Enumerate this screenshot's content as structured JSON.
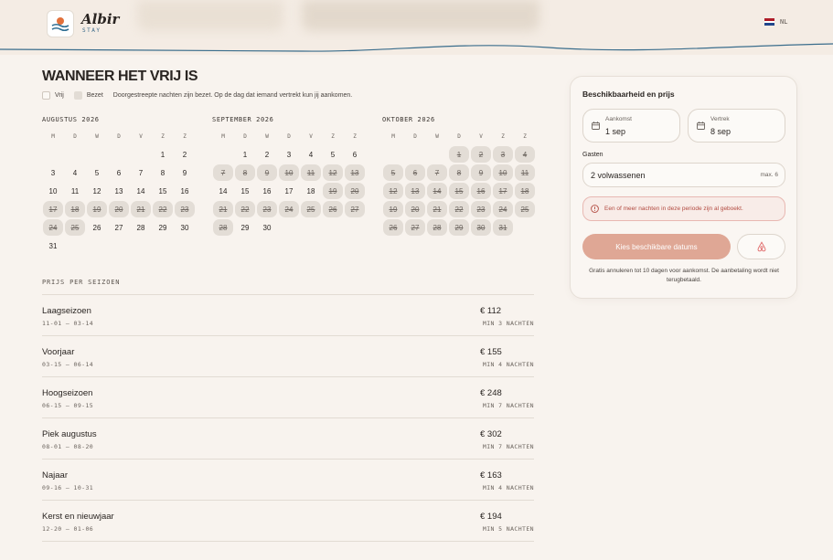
{
  "brand": {
    "name": "Albir",
    "sub": "STAY"
  },
  "language": "NL",
  "availability": {
    "title": "WANNEER HET VRIJ IS",
    "legend": {
      "free": "Vrij",
      "busy": "Bezet",
      "note": "Doorgestreepte nachten zijn bezet. Op de dag dat iemand vertrekt kun jij aankomen."
    },
    "weekdays": [
      "M",
      "D",
      "W",
      "D",
      "V",
      "Z",
      "Z"
    ],
    "months": [
      {
        "name": "AUGUSTUS 2026",
        "offset": 5,
        "days": 31,
        "busy": [
          17,
          18,
          19,
          20,
          21,
          22,
          23,
          24,
          25
        ]
      },
      {
        "name": "SEPTEMBER 2026",
        "offset": 1,
        "days": 30,
        "busy": [
          7,
          8,
          9,
          10,
          11,
          12,
          13,
          19,
          20,
          21,
          22,
          23,
          24,
          25,
          26,
          27,
          28
        ]
      },
      {
        "name": "OKTOBER 2026",
        "offset": 3,
        "days": 31,
        "busy": [
          1,
          2,
          3,
          4,
          5,
          6,
          7,
          8,
          9,
          10,
          11,
          12,
          13,
          14,
          15,
          16,
          17,
          18,
          19,
          20,
          21,
          22,
          23,
          24,
          25,
          26,
          27,
          28,
          29,
          30,
          31
        ]
      }
    ]
  },
  "prices": {
    "heading": "PRIJS PER SEIZOEN",
    "seasons": [
      {
        "name": "Laagseizoen",
        "dates": "11-01 – 03-14",
        "price": "€ 112",
        "min": "MIN 3 NACHTEN"
      },
      {
        "name": "Voorjaar",
        "dates": "03-15 – 06-14",
        "price": "€ 155",
        "min": "MIN 4 NACHTEN"
      },
      {
        "name": "Hoogseizoen",
        "dates": "06-15 – 09-15",
        "price": "€ 248",
        "min": "MIN 7 NACHTEN"
      },
      {
        "name": "Piek augustus",
        "dates": "08-01 – 08-20",
        "price": "€ 302",
        "min": "MIN 7 NACHTEN"
      },
      {
        "name": "Najaar",
        "dates": "09-16 – 10-31",
        "price": "€ 163",
        "min": "MIN 4 NACHTEN"
      },
      {
        "name": "Kerst en nieuwjaar",
        "dates": "12-20 – 01-06",
        "price": "€ 194",
        "min": "MIN 5 NACHTEN"
      }
    ]
  },
  "booking": {
    "title": "Beschikbaarheid en prijs",
    "checkin": {
      "label": "Aankomst",
      "value": "1 sep"
    },
    "checkout": {
      "label": "Vertrek",
      "value": "8 sep"
    },
    "guests_label": "Gasten",
    "guests_value": "2 volwassenen",
    "guests_max": "max. 6",
    "alert": "Een of meer nachten in deze periode zijn al geboekt.",
    "cta": "Kies beschikbare datums",
    "note": "Gratis annuleren tot 10 dagen voor aankomst. De aanbetaling wordt niet terugbetaald."
  },
  "colors": {
    "accent": "#dfa795",
    "busy": "#e3ddd6",
    "alert": "#b24a40",
    "background": "#f8f3ee"
  },
  "icons": [
    "logo-icon",
    "netherlands-flag-icon",
    "calendar-icon",
    "alert-icon",
    "airbnb-icon"
  ]
}
